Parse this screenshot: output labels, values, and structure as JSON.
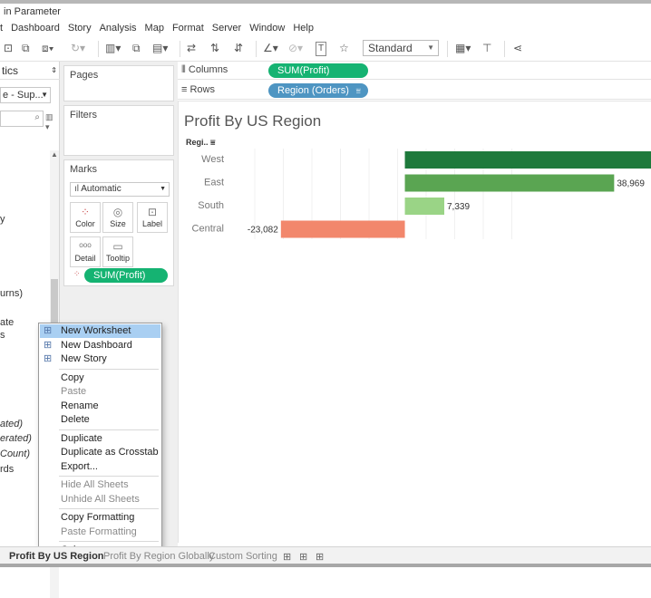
{
  "window": {
    "title": "in Parameter"
  },
  "menubar": [
    "t",
    "Dashboard",
    "Story",
    "Analysis",
    "Map",
    "Format",
    "Server",
    "Window",
    "Help"
  ],
  "toolbar": {
    "fit_select": "Standard"
  },
  "left_pane": {
    "header": "tics",
    "datasource": "e - Sup...",
    "fragments": [
      "y",
      "urns)",
      "ate",
      "s",
      "ated)",
      "erated)",
      "Count)",
      "rds"
    ]
  },
  "cards": {
    "pages": "Pages",
    "filters": "Filters",
    "marks": "Marks",
    "mark_type": "Automatic"
  },
  "marks_buttons": {
    "color": "Color",
    "size": "Size",
    "label": "Label",
    "detail": "Detail",
    "tooltip": "Tooltip"
  },
  "marks_pill": "SUM(Profit)",
  "shelves": {
    "columns": {
      "label": "Columns",
      "pill": "SUM(Profit)"
    },
    "rows": {
      "label": "Rows",
      "pill": "Region (Orders)"
    }
  },
  "view": {
    "title": "Profit By US Region",
    "row_header": "Regi.."
  },
  "chart_data": {
    "type": "bar",
    "orientation": "horizontal",
    "title": "Profit By US Region",
    "categories": [
      "West",
      "East",
      "South",
      "Central"
    ],
    "values": [
      null,
      38969,
      7339,
      -23082
    ],
    "data_labels": [
      "",
      "38,969",
      "7,339",
      "-23,082"
    ],
    "colors": [
      "#1e7a3c",
      "#5aa552",
      "#9ad486",
      "#f2876c"
    ],
    "xlim": [
      -32000,
      46000
    ]
  },
  "context_menu": [
    {
      "label": "New Worksheet",
      "icon": "new-worksheet-icon",
      "highlighted": true
    },
    {
      "label": "New Dashboard",
      "icon": "new-dashboard-icon"
    },
    {
      "label": "New Story",
      "icon": "new-story-icon"
    },
    {
      "separator": true
    },
    {
      "label": "Copy"
    },
    {
      "label": "Paste",
      "disabled": true
    },
    {
      "label": "Rename"
    },
    {
      "label": "Delete"
    },
    {
      "separator": true
    },
    {
      "label": "Duplicate"
    },
    {
      "label": "Duplicate as Crosstab"
    },
    {
      "label": "Export..."
    },
    {
      "separator": true
    },
    {
      "label": "Hide All Sheets",
      "disabled": true
    },
    {
      "label": "Unhide All Sheets",
      "disabled": true
    },
    {
      "separator": true
    },
    {
      "label": "Copy Formatting"
    },
    {
      "label": "Paste Formatting",
      "disabled": true
    },
    {
      "separator": true
    },
    {
      "label": "Color",
      "submenu": true
    }
  ],
  "sheet_tabs": [
    "Profit By US Region",
    "Profit By Region Globally",
    "Custom Sorting"
  ]
}
